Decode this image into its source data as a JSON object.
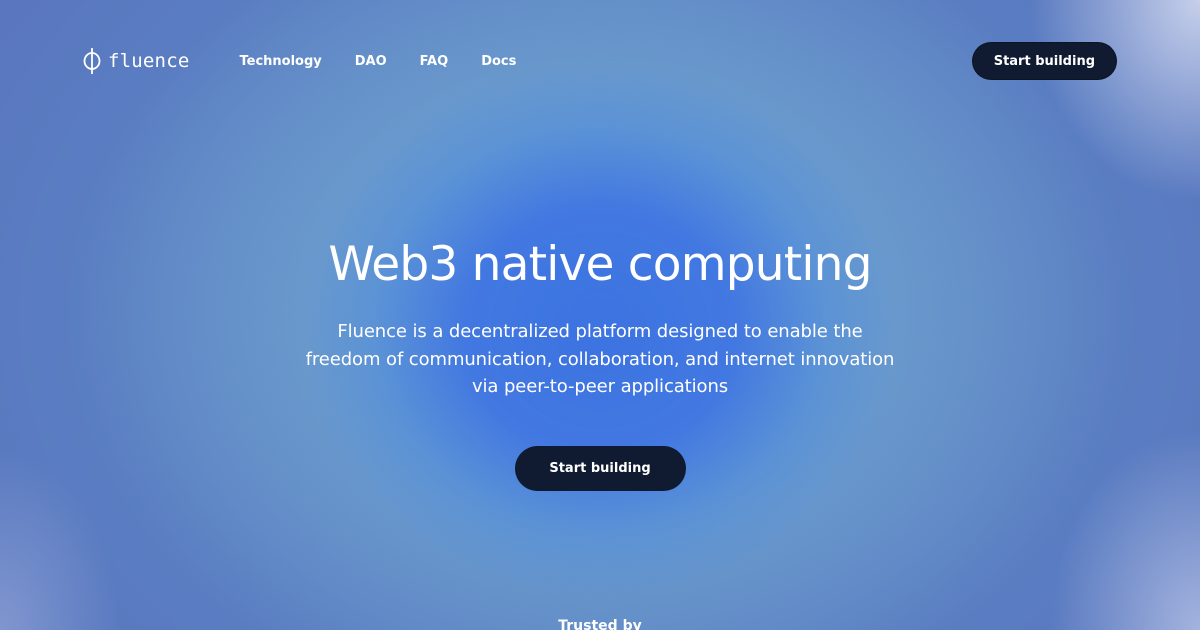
{
  "brand": {
    "name": "fluence",
    "icon": "phi-logo-icon"
  },
  "nav": {
    "items": [
      {
        "label": "Technology"
      },
      {
        "label": "DAO"
      },
      {
        "label": "FAQ"
      },
      {
        "label": "Docs"
      }
    ]
  },
  "header": {
    "cta_label": "Start building"
  },
  "hero": {
    "title": "Web3 native computing",
    "description": "Fluence is a decentralized platform designed to enable the freedom of communication, collaboration, and internet innovation via peer-to-peer applications",
    "cta_label": "Start building"
  },
  "trusted": {
    "label": "Trusted by"
  },
  "colors": {
    "button_bg": "#101a30",
    "text": "#ffffff",
    "background_center": "#3c73e1",
    "background_edge": "#5a6fba"
  }
}
